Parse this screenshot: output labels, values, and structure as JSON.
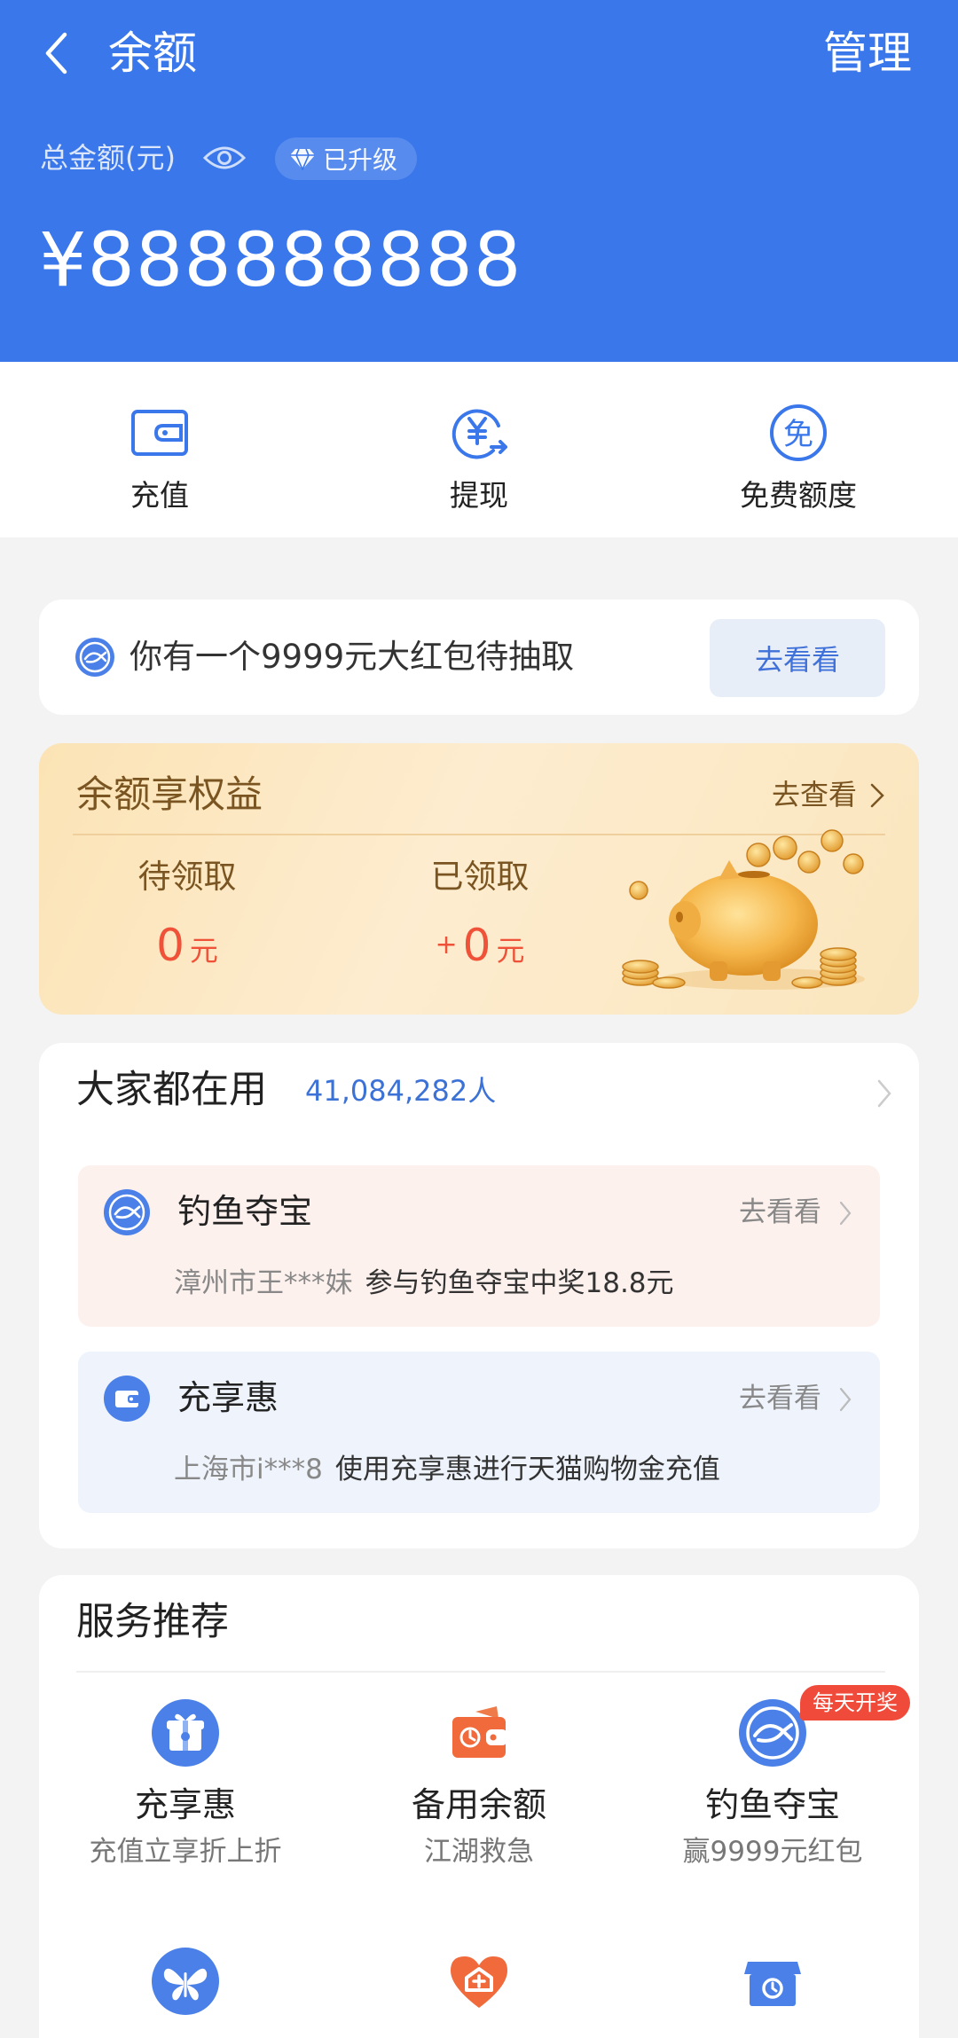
{
  "header": {
    "title": "余额",
    "manage_label": "管理",
    "total_label": "总金额(元)",
    "upgrade_badge": "已升级",
    "balance": "¥888888888",
    "bg_color": "#3a77eb"
  },
  "actions": [
    {
      "label": "充值",
      "icon": "wallet-icon"
    },
    {
      "label": "提现",
      "icon": "withdraw-yuan-icon"
    },
    {
      "label": "免费额度",
      "icon": "free-quota-icon"
    }
  ],
  "promo": {
    "text": "你有一个9999元大红包待抽取",
    "button": "去看看",
    "icon": "fish-icon"
  },
  "rights": {
    "title": "余额享权益",
    "link": "去查看",
    "pending": {
      "label": "待领取",
      "value": "0",
      "unit": "元"
    },
    "received": {
      "label": "已领取",
      "prefix": "+",
      "value": "0",
      "unit": "元"
    },
    "image": "gold-piggy-bank-icon"
  },
  "popular": {
    "title": "大家都在用",
    "count": "41,084,282人",
    "items": [
      {
        "name": "钓鱼夺宝",
        "link": "去看看",
        "who": "漳州市王***妹",
        "desc": "参与钓鱼夺宝中奖18.8元",
        "icon": "fish-icon"
      },
      {
        "name": "充享惠",
        "link": "去看看",
        "who": "上海市i***8",
        "desc": "使用充享惠进行天猫购物金充值",
        "icon": "wallet-icon"
      }
    ]
  },
  "services": {
    "title": "服务推荐",
    "items": [
      {
        "name": "充享惠",
        "sub": "充值立享折上折",
        "icon": "gift-icon"
      },
      {
        "name": "备用余额",
        "sub": "江湖救急",
        "icon": "wallet-icon"
      },
      {
        "name": "钓鱼夺宝",
        "sub": "赢9999元红包",
        "icon": "fish-icon",
        "badge": "每天开奖"
      },
      {
        "name": "",
        "sub": "",
        "icon": "butterfly-icon"
      },
      {
        "name": "",
        "sub": "",
        "icon": "heart-icon"
      },
      {
        "name": "",
        "sub": "",
        "icon": "store-icon"
      }
    ]
  }
}
